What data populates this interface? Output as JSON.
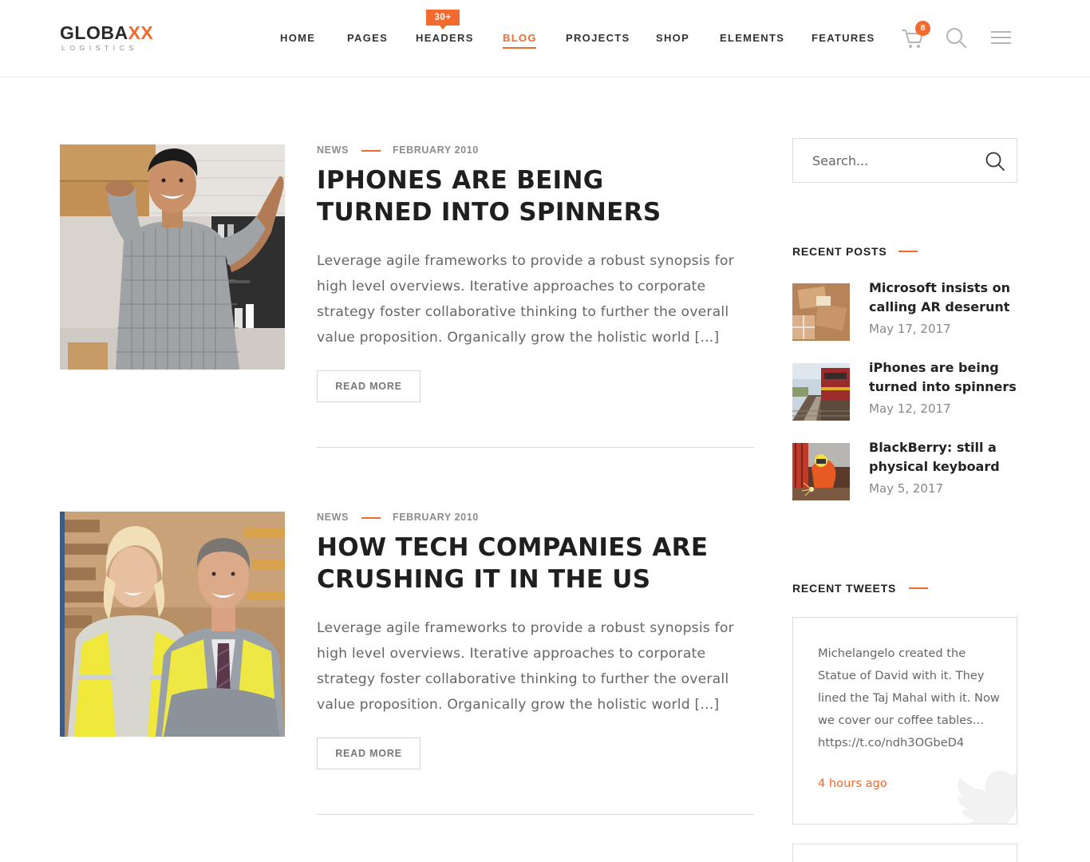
{
  "brand": {
    "name_start": "GLOBA",
    "name_accent": "XX",
    "tagline": "LOGISTICS",
    "accent_color": "#f26a2e"
  },
  "nav": {
    "items": [
      {
        "label": "HOME",
        "active": false
      },
      {
        "label": "PAGES",
        "active": false
      },
      {
        "label": "HEADERS",
        "active": false,
        "badge": "30+"
      },
      {
        "label": "BLOG",
        "active": true
      },
      {
        "label": "PROJECTS",
        "active": false
      },
      {
        "label": "SHOP",
        "active": false
      },
      {
        "label": "ELEMENTS",
        "active": false
      },
      {
        "label": "FEATURES",
        "active": false
      }
    ],
    "cart_count": "8"
  },
  "posts": [
    {
      "category": "NEWS",
      "date": "FEBRUARY 2010",
      "title_line1": "IPHONES ARE BEING",
      "title_line2": "TURNED INTO SPINNERS",
      "excerpt": "Leverage agile frameworks to provide a robust synopsis for high level overviews. Iterative approaches to corporate strategy foster collaborative thinking to further the overall value proposition. Organically grow the holistic world [...]",
      "read_more": "READ MORE",
      "image": "worker-carrying-boxes"
    },
    {
      "category": "NEWS",
      "date": "FEBRUARY 2010",
      "title_line1": "HOW TECH COMPANIES ARE",
      "title_line2": "CRUSHING IT IN THE US",
      "excerpt": "Leverage agile frameworks to provide a robust synopsis for high level overviews. Iterative approaches to corporate strategy foster collaborative thinking to further the overall value proposition. Organically grow the holistic world [...]",
      "read_more": "READ MORE",
      "image": "warehouse-workers-in-vests"
    }
  ],
  "sidebar": {
    "search_placeholder": "Search...",
    "recent_posts_title": "RECENT POSTS",
    "recent_posts": [
      {
        "title": "Microsoft insists on calling AR deserunt",
        "date": "May 17, 2017",
        "image": "parcels"
      },
      {
        "title": "iPhones are being turned into spinners",
        "date": "May 12, 2017",
        "image": "train"
      },
      {
        "title": "BlackBerry: still a physical keyboard",
        "date": "May 5, 2017",
        "image": "welder"
      }
    ],
    "recent_tweets_title": "RECENT TWEETS",
    "tweet": {
      "text": "Michelangelo created the Statue of David with it. They lined the Taj Mahal with it. Now we cover our coffee tables… https://t.co/ndh3OGbeD4",
      "time": "4 hours ago"
    }
  }
}
